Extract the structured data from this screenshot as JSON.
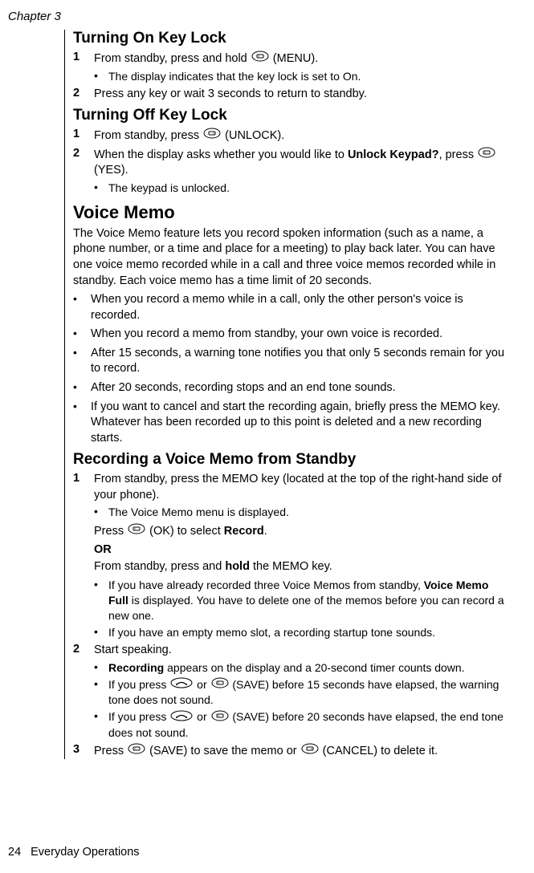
{
  "chapter": "Chapter 3",
  "sections": {
    "s1": {
      "title": "Turning On Key Lock",
      "step1_num": "1",
      "step1_a": "From standby, press and hold ",
      "step1_b": " (MENU).",
      "sub1": "The display indicates that the key lock is set to On.",
      "step2_num": "2",
      "step2": "Press any key or wait 3 seconds to return to standby."
    },
    "s2": {
      "title": "Turning Off Key Lock",
      "step1_num": "1",
      "step1_a": "From standby, press ",
      "step1_b": " (UNLOCK).",
      "step2_num": "2",
      "step2_a": "When the display asks whether you would like to ",
      "step2_bold": "Unlock Keypad?",
      "step2_b": ", press ",
      "step2_c": " (YES).",
      "sub1": "The keypad is unlocked."
    },
    "s3": {
      "title": "Voice Memo",
      "intro": "The Voice Memo feature lets you record spoken information (such as a name, a phone number, or a time and place for a meeting) to play back later. You can have one voice memo recorded while in a call and three voice memos recorded while in standby. Each voice memo has a time limit of 20 seconds.",
      "b1": "When you record a memo while in a call, only the other person's voice is recorded.",
      "b2": "When you record a memo from standby, your own voice is recorded.",
      "b3": "After 15 seconds, a warning tone notifies you that only 5 seconds remain for you to record.",
      "b4": "After 20 seconds, recording stops and an end tone sounds.",
      "b5": "If you want to cancel and start the recording again, briefly press the MEMO key. Whatever has been recorded up to this point is deleted and a new recording starts."
    },
    "s4": {
      "title": "Recording a Voice Memo from Standby",
      "step1_num": "1",
      "step1": "From standby, press the MEMO key (located at the top of the right-hand side of your phone).",
      "sub1": "The Voice Memo menu is displayed.",
      "press_a": "Press ",
      "press_b": " (OK) to select ",
      "press_bold": "Record",
      "press_c": ".",
      "or": "OR",
      "alt_a": "From standby, press and ",
      "alt_bold": "hold",
      "alt_b": " the MEMO key.",
      "sub2_a": "If you have already recorded three Voice Memos from standby, ",
      "sub2_bold": "Voice Memo Full",
      "sub2_b": " is displayed. You have to delete one of the memos before you can record a new one.",
      "sub3": "If you have an empty memo slot, a recording startup tone sounds.",
      "step2_num": "2",
      "step2": "Start speaking.",
      "sub4_bold": "Recording",
      "sub4_b": " appears on the display and a 20-second timer counts down.",
      "sub5_a": "If you press ",
      "sub5_b": " or ",
      "sub5_c": " (SAVE) before 15 seconds have elapsed, the warning tone does not sound.",
      "sub6_a": "If you press ",
      "sub6_b": " or ",
      "sub6_c": " (SAVE) before 20 seconds have elapsed, the end tone does not sound.",
      "step3_num": "3",
      "step3_a": "Press ",
      "step3_b": " (SAVE) to save the memo or ",
      "step3_c": " (CANCEL) to delete it."
    }
  },
  "footer": {
    "page_number": "24",
    "footer_text": "Everyday Operations"
  }
}
